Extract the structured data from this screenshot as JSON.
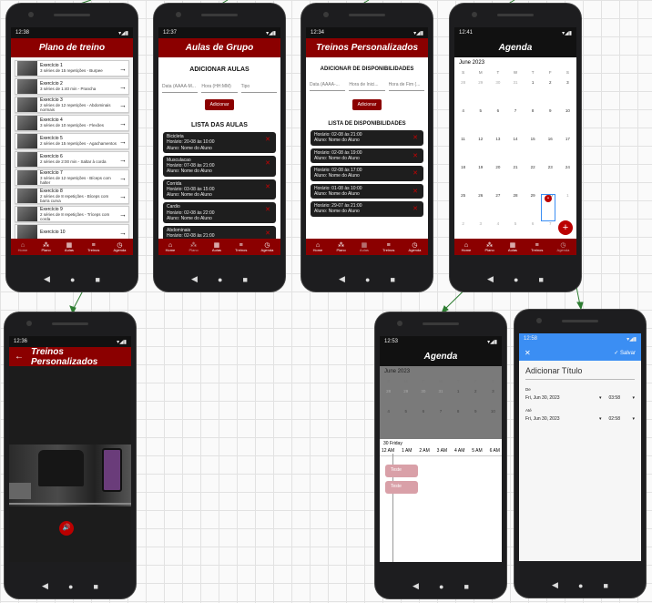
{
  "plano": {
    "time": "12:38",
    "title": "Plano de treino",
    "items": [
      {
        "name": "Exercício 1",
        "desc": "3 séries de 15 repetições - Burpee"
      },
      {
        "name": "Exercício 2",
        "desc": "3 séries de 1:40 min - Prancha"
      },
      {
        "name": "Exercício 3",
        "desc": "2 séries de 12 repetições - Abdominais normais"
      },
      {
        "name": "Exercício 4",
        "desc": "3 séries de 10 repetições - Flexões"
      },
      {
        "name": "Exercício 5",
        "desc": "2 séries de 15 repetições - Agachamentos"
      },
      {
        "name": "Exercício 6",
        "desc": "2 séries de 2:00 min - Saltar à corda"
      },
      {
        "name": "Exercício 7",
        "desc": "3 séries de 12 repetições - Bíceps com halter"
      },
      {
        "name": "Exercício 8",
        "desc": "2 séries de 8 repetições - Bíceps com barra curva"
      },
      {
        "name": "Exercício 9",
        "desc": "2 séries de 8 repetições - Tríceps com corda"
      },
      {
        "name": "Exercício 10",
        "desc": ""
      }
    ]
  },
  "nav": [
    {
      "label": "Home",
      "glyph": "⌂"
    },
    {
      "label": "Plano",
      "glyph": "⁂"
    },
    {
      "label": "Aulas",
      "glyph": "▦"
    },
    {
      "label": "Treinos",
      "glyph": "≡"
    },
    {
      "label": "Agenda",
      "glyph": "◷"
    }
  ],
  "aulas": {
    "time": "12:37",
    "title": "Aulas de Grupo",
    "add_heading": "ADICIONAR AULAS",
    "fields": [
      "Data (AAAA-M...",
      "Hora (HH:MM)",
      "Tipo"
    ],
    "add_button": "Adicionar",
    "list_heading": "LISTA DAS AULAS",
    "items": [
      {
        "name": "Bicicleta",
        "sched": "Horário: 20-08 às 10:00",
        "who": "Aluno: Nome do Aluno"
      },
      {
        "name": "Musculacao",
        "sched": "Horário: 07-08 às 21:00",
        "who": "Aluno: Nome do Aluno"
      },
      {
        "name": "Corrida",
        "sched": "Horário: 03-08 às 15:00",
        "who": "Aluno: Nome do Aluno"
      },
      {
        "name": "Cardio",
        "sched": "Horário: 02-08 às 22:00",
        "who": "Aluno: Nome do Aluno"
      },
      {
        "name": "Abdominais",
        "sched": "Horário: 02-08 às 21:00",
        "who": "Aluno: Nome do Aluno"
      }
    ]
  },
  "pers": {
    "time": "12:34",
    "title": "Treinos Personalizados",
    "add_heading": "ADICIONAR DE DISPONIBILIDADES",
    "fields": [
      "Data (AAAA-...",
      "Hora de Inici...",
      "Hora de Fim (..."
    ],
    "add_button": "Adicionar",
    "list_heading": "LISTA DE DISPONIBILIDADES",
    "items": [
      {
        "sched": "Horário: 02-08 às 21:00",
        "who": "Aluno: Nome do Aluno"
      },
      {
        "sched": "Horário: 02-08 às 19:00",
        "who": "Aluno: Nome do Aluno"
      },
      {
        "sched": "Horário: 02-08 às 17:00",
        "who": "Aluno: Nome do Aluno"
      },
      {
        "sched": "Horário: 01-08 às 10:00",
        "who": "Aluno: Nome do Aluno"
      },
      {
        "sched": "Horário: 29-07 às 21:00",
        "who": "Aluno: Nome do Aluno"
      }
    ]
  },
  "agenda": {
    "time": "12:41",
    "title": "Agenda",
    "month": "June 2023",
    "weekdays": [
      "S",
      "M",
      "T",
      "W",
      "T",
      "F",
      "S"
    ],
    "days": [
      "28",
      "29",
      "30",
      "31",
      "1",
      "2",
      "3",
      "4",
      "5",
      "6",
      "7",
      "8",
      "9",
      "10",
      "11",
      "12",
      "13",
      "14",
      "15",
      "16",
      "17",
      "18",
      "19",
      "20",
      "21",
      "22",
      "23",
      "24",
      "25",
      "26",
      "27",
      "28",
      "29",
      "30",
      "1",
      "2",
      "3",
      "4",
      "5",
      "6",
      "7",
      "8"
    ]
  },
  "video": {
    "time": "12:36",
    "title": "Treinos Personalizados",
    "back": "←",
    "sound": "🔊"
  },
  "agenda_day": {
    "time": "12:53",
    "title": "Agenda",
    "month": "June 2023",
    "day_label": "30 Friday",
    "hours": [
      "12 AM",
      "1 AM",
      "2 AM",
      "3 AM",
      "4 AM",
      "5 AM",
      "6 AM"
    ],
    "event1": "Teste",
    "event2": "Teste"
  },
  "novo": {
    "time": "12:58",
    "close": "✕",
    "save": "✓ Salvar",
    "title_placeholder": "Adicionar Título",
    "from_label": "De",
    "from_date": "Fri, Jun 30, 2023",
    "from_time": "03:58",
    "to_label": "Até",
    "to_date": "Fri, Jun 30, 2023",
    "to_time": "02:58"
  },
  "colors": {
    "accent": "#8b0000",
    "event": "#d9a0a8",
    "blue": "#3b8ef3",
    "arrow": "#2e7d32"
  }
}
